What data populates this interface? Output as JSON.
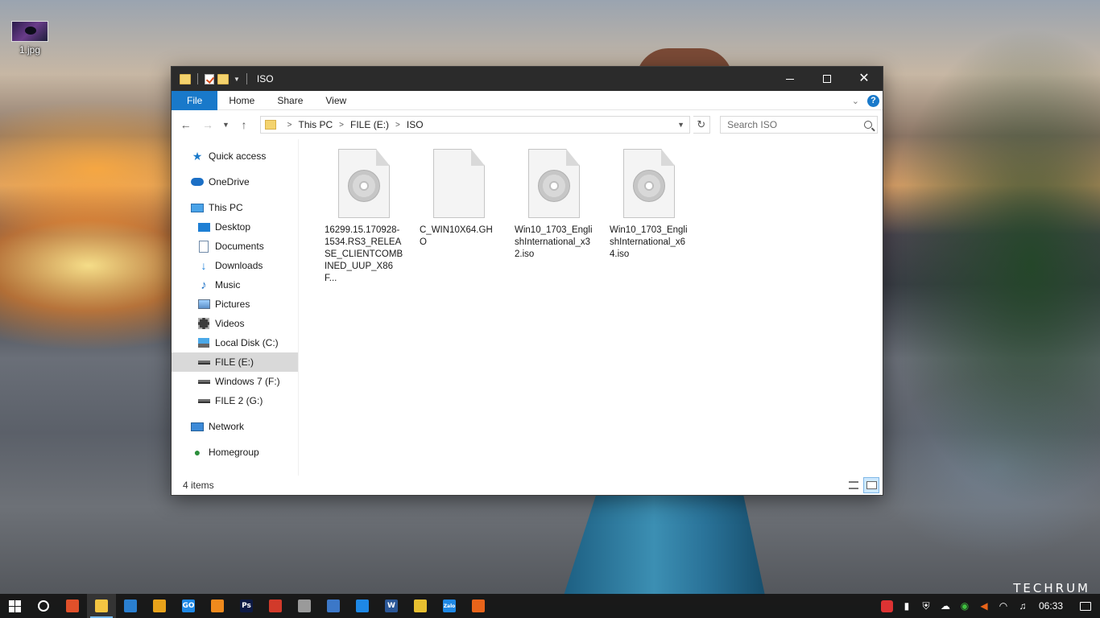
{
  "desktop": {
    "icon_label": "1.jpg",
    "watermark": "TECHRUM"
  },
  "window": {
    "title": "ISO",
    "ribbon_tabs": [
      "File",
      "Home",
      "Share",
      "View"
    ],
    "address": {
      "crumbs": [
        "This PC",
        "FILE (E:)",
        "ISO"
      ]
    },
    "search": {
      "placeholder": "Search ISO"
    },
    "nav_pane": [
      {
        "label": "Quick access",
        "icon": "star-icon"
      },
      {
        "label": "OneDrive",
        "icon": "cloud-icon"
      },
      {
        "label": "This PC",
        "icon": "computer-icon"
      },
      {
        "label": "Desktop",
        "icon": "desktop-folder-icon"
      },
      {
        "label": "Documents",
        "icon": "documents-icon"
      },
      {
        "label": "Downloads",
        "icon": "download-arrow-icon"
      },
      {
        "label": "Music",
        "icon": "music-note-icon"
      },
      {
        "label": "Pictures",
        "icon": "pictures-icon"
      },
      {
        "label": "Videos",
        "icon": "film-icon"
      },
      {
        "label": "Local Disk (C:)",
        "icon": "system-drive-icon"
      },
      {
        "label": "FILE (E:)",
        "icon": "drive-icon"
      },
      {
        "label": "Windows 7 (F:)",
        "icon": "drive-icon"
      },
      {
        "label": "FILE 2 (G:)",
        "icon": "drive-icon"
      },
      {
        "label": "Network",
        "icon": "network-icon"
      },
      {
        "label": "Homegroup",
        "icon": "homegroup-icon"
      }
    ],
    "files": [
      {
        "name": "16299.15.170928-1534.RS3_RELEASE_CLIENTCOMBINED_UUP_X86F...",
        "icon": "disc-image-icon"
      },
      {
        "name": "C_WIN10X64.GHO",
        "icon": "blank-file-icon"
      },
      {
        "name": "Win10_1703_EnglishInternational_x32.iso",
        "icon": "disc-image-icon"
      },
      {
        "name": "Win10_1703_EnglishInternational_x64.iso",
        "icon": "disc-image-icon"
      }
    ],
    "status": {
      "item_count": "4 items"
    }
  },
  "taskbar": {
    "apps": [
      {
        "name": "paint-app-icon",
        "color": "#e0502a",
        "glyph": ""
      },
      {
        "name": "file-explorer-icon",
        "color": "#f4c542",
        "glyph": ""
      },
      {
        "name": "3d-box-app-icon",
        "color": "#2a7fd0",
        "glyph": ""
      },
      {
        "name": "media-player-icon",
        "color": "#e8a21a",
        "glyph": ""
      },
      {
        "name": "gotv-icon",
        "color": "#1e88e5",
        "glyph": "GO"
      },
      {
        "name": "archive-app-icon",
        "color": "#f08a1d",
        "glyph": ""
      },
      {
        "name": "photoshop-icon",
        "color": "#0d1a45",
        "glyph": "Ps"
      },
      {
        "name": "media-codec-icon",
        "color": "#d23a2a",
        "glyph": ""
      },
      {
        "name": "snipping-tool-icon",
        "color": "#9a9a9a",
        "glyph": ""
      },
      {
        "name": "network-tool-icon",
        "color": "#3c78c8",
        "glyph": ""
      },
      {
        "name": "messenger-icon",
        "color": "#1e88e5",
        "glyph": ""
      },
      {
        "name": "word-icon",
        "color": "#2b5797",
        "glyph": "W"
      },
      {
        "name": "chrome-icon",
        "color": "#e8c030",
        "glyph": ""
      },
      {
        "name": "zalo-icon",
        "color": "#1e88e5",
        "glyph": "Zalo"
      },
      {
        "name": "firefox-icon",
        "color": "#e8641a",
        "glyph": ""
      }
    ],
    "tray_icons": [
      "vivaldi-icon",
      "usb-icon",
      "shield-icon",
      "network-cloud-icon",
      "security-icon",
      "volume-mute-icon",
      "wifi-icon",
      "speaker-icon"
    ],
    "clock": "06:33"
  }
}
